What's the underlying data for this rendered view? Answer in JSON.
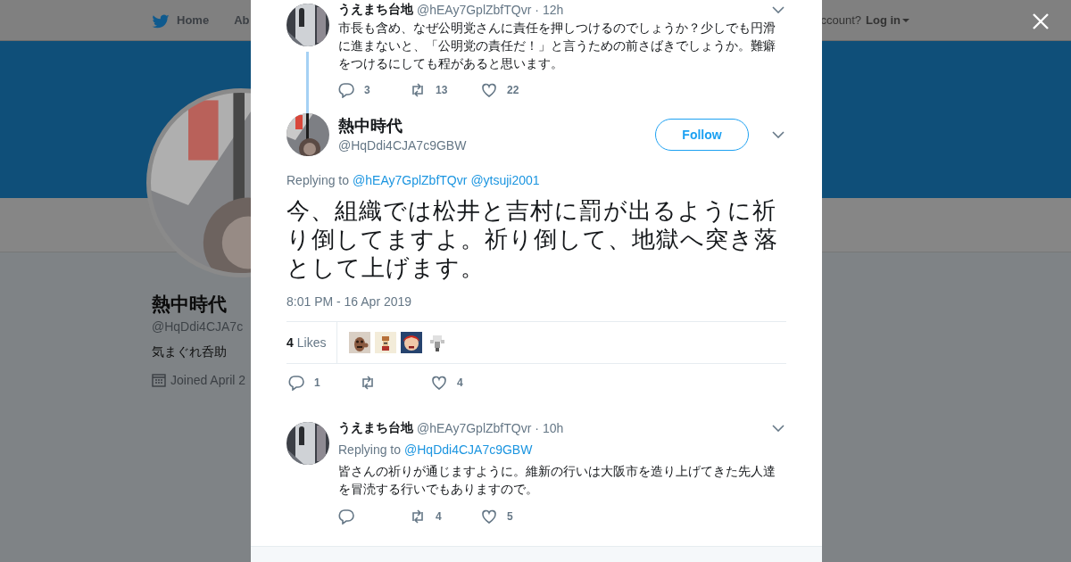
{
  "background_page": {
    "nav": [
      {
        "kind": "home",
        "label": "Home"
      },
      {
        "kind": "link",
        "label": "Ab"
      }
    ],
    "login_prompt": "ccount?",
    "login": "Log in",
    "profile": {
      "name": "熱中時代",
      "handle": "@HqDdi4CJA7c",
      "bio": "気まぐれ呑助",
      "joined": "Joined April 2"
    }
  },
  "modal": {
    "parent_tweet": {
      "name": "うえまち台地",
      "handle": "@hEAy7GplZbfTQvr",
      "time": "· 12h",
      "text": "市長も含め、なぜ公明党さんに責任を押しつけるのでしょうか？少しでも円滑に進まないと、「公明党の責任だ！」と言うための前さばきでしょうか。難癖をつけるにしても程があると思います。",
      "stats": {
        "replies": "3",
        "retweets": "13",
        "likes": "22"
      }
    },
    "main_tweet": {
      "name": "熱中時代",
      "handle": "@HqDdi4CJA7c9GBW",
      "follow": "Follow",
      "replying_label": "Replying to",
      "replying_to": [
        "@hEAy7GplZbfTQvr",
        "@ytsuji2001"
      ],
      "text": "今、組織では松井と吉村に罰が出るように祈り倒してますよ。祈り倒して、地獄へ突き落として上げます。",
      "timestamp": "8:01 PM - 16 Apr 2019",
      "likes_count": "4",
      "likes_label": "Likes",
      "stats": {
        "replies": "1",
        "likes": "4"
      }
    },
    "replies": [
      {
        "name": "うえまち台地",
        "handle": "@hEAy7GplZbfTQvr",
        "time": "· 10h",
        "replying_label": "Replying to",
        "replying_to": [
          "@HqDdi4CJA7c9GBW"
        ],
        "text": "皆さんの祈りが通じますように。維新の行いは大阪市を造り上げてきた先人達を冒涜する行いでもありますので。",
        "stats": {
          "retweets": "4",
          "likes": "5"
        }
      }
    ]
  }
}
